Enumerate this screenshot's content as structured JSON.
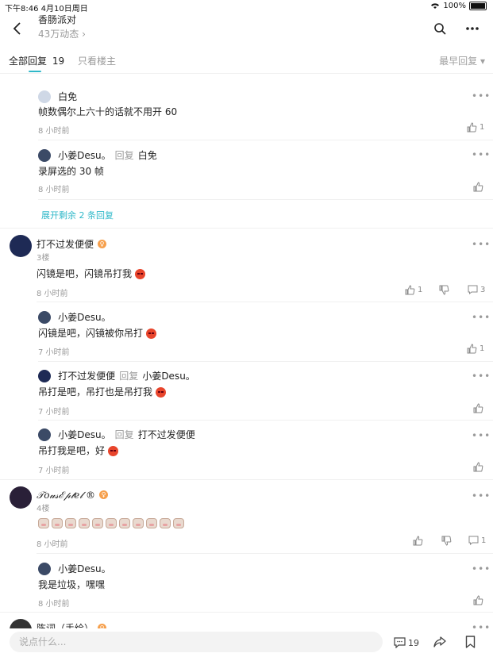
{
  "status_bar": {
    "time": "下午8:46  4月10日周日",
    "battery": "100%"
  },
  "header": {
    "title": "香肠派对",
    "subtitle": "43万动态 ›"
  },
  "tabs": {
    "all_label": "全部回复",
    "all_count": "19",
    "owner_only": "只看楼主",
    "sort": "最早回复 ▾"
  },
  "replies_top": [
    {
      "name": "白免",
      "text": "帧数偶尔上六十的话就不用开 60",
      "time": "8 小时前",
      "likes": "1"
    },
    {
      "name": "小姜Desu。",
      "reply_word": "回复",
      "reply_to": "白免",
      "text": "录屏选的 30 帧",
      "time": "8 小时前"
    }
  ],
  "expand_label": "展开剩余 2 条回复",
  "comment3": {
    "name": "打不过发便便",
    "floor": "3楼",
    "text": "闪镜是吧，闪镜吊打我",
    "time": "8 小时前",
    "likes": "1",
    "replies": "3",
    "sub": [
      {
        "name": "小姜Desu。",
        "text": "闪镜是吧，闪镜被你吊打",
        "time": "7 小时前",
        "likes": "1"
      },
      {
        "name": "打不过发便便",
        "reply_word": "回复",
        "reply_to": "小姜Desu。",
        "text": "吊打是吧，吊打也是吊打我",
        "time": "7 小时前"
      },
      {
        "name": "小姜Desu。",
        "reply_word": "回复",
        "reply_to": "打不过发便便",
        "text": "吊打我是吧，好",
        "time": "7 小时前"
      }
    ]
  },
  "comment4": {
    "name": "𝒯𝑜𝓊𝓈ℰ𝓅𝓉𝑒𝓁 ®",
    "floor": "4楼",
    "time": "8 小时前",
    "replies": "1",
    "sub": [
      {
        "name": "小姜Desu。",
        "text": "我是垃圾，嘿嘿",
        "time": "8 小时前"
      }
    ]
  },
  "comment5": {
    "name": "陈词（手绘）"
  },
  "bottom": {
    "placeholder": "说点什么...",
    "comment_count": "19"
  },
  "colors": {
    "accent": "#2fb8c9",
    "badge": "#f6a04d"
  }
}
